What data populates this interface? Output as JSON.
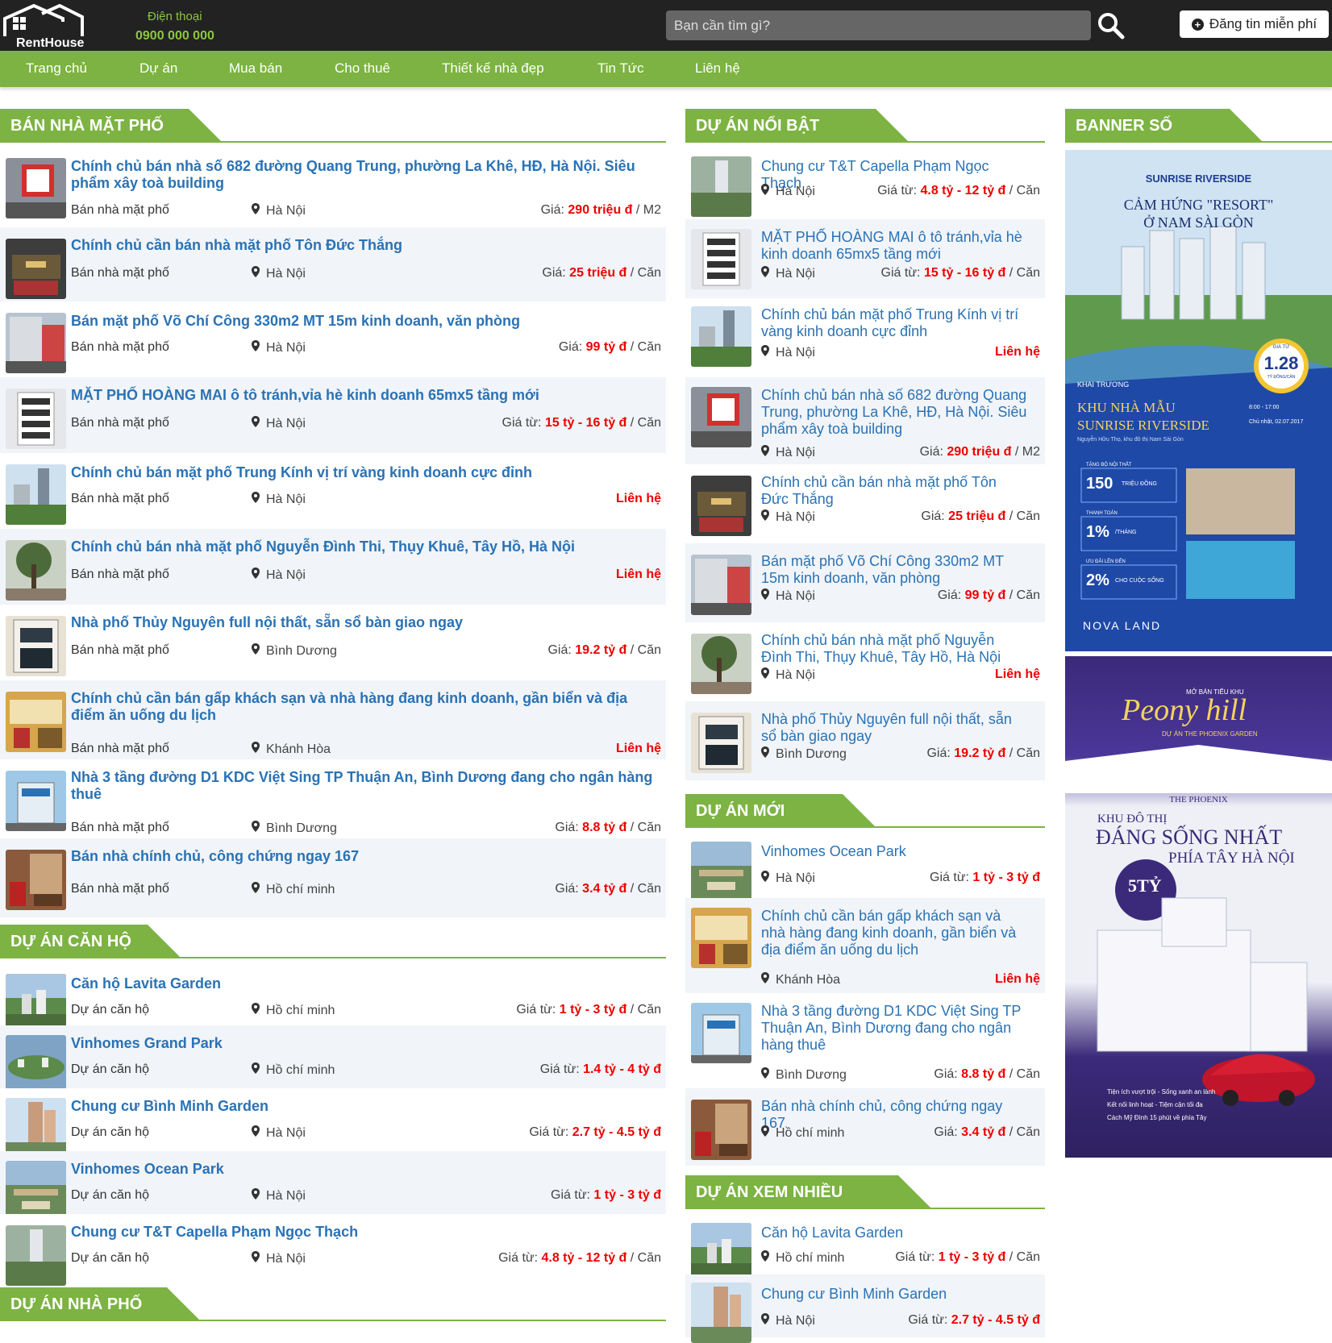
{
  "header": {
    "logo": "RentHouse",
    "phone_label": "Điện thoại",
    "phone": "0900 000 000",
    "search_placeholder": "Bạn cần tìm gì?",
    "post_label": "Đăng tin miễn phí"
  },
  "nav": [
    "Trang chủ",
    "Dự án",
    "Mua bán",
    "Cho thuê",
    "Thiết kế nhà đẹp",
    "Tin Tức",
    "Liên hệ"
  ],
  "sections": {
    "ban_nha": "BÁN NHÀ MẶT PHỐ",
    "can_ho": "DỰ ÁN CĂN HỘ",
    "nha_pho": "DỰ ÁN NHÀ PHỐ",
    "noi_bat": "DỰ ÁN NỔI BẬT",
    "moi": "DỰ ÁN MỚI",
    "xem_nhieu": "DỰ ÁN XEM NHIỀU",
    "banner": "BANNER SỐ"
  },
  "ban_nha": [
    {
      "title": "Chính chủ bán nhà số 682 đường Quang Trung, phường La Khê, HĐ, Hà Nội. Siêu phẩm xây toà building",
      "cat": "Bán nhà mặt phố",
      "loc": "Hà Nội",
      "pl": "Giá: ",
      "pv": "290 triệu đ",
      "pu": " / M2",
      "thumb": "red"
    },
    {
      "title": "Chính chủ cần bán nhà mặt phố Tôn Đức Thắng",
      "cat": "Bán nhà mặt phố",
      "loc": "Hà Nội",
      "pl": "Giá: ",
      "pv": "25 triệu đ",
      "pu": " / Căn",
      "thumb": "shop"
    },
    {
      "title": "Bán mặt phố Võ Chí Công 330m2 MT 15m kinh doanh, văn phòng",
      "cat": "Bán nhà mặt phố",
      "loc": "Hà Nội",
      "pl": "Giá: ",
      "pv": "99 tỷ đ",
      "pu": " / Căn",
      "thumb": "street"
    },
    {
      "title": "MẶT PHỐ HOÀNG MAI ô tô tránh,vỉa hè kinh doanh 65mx5 tầng mới",
      "cat": "Bán nhà mặt phố",
      "loc": "Hà Nội",
      "pl": "Giá từ: ",
      "pv": "15 tỷ - 16 tỷ đ",
      "pu": " / Căn",
      "thumb": "white"
    },
    {
      "title": "Chính chủ bán mặt phố Trung Kính vị trí vàng kinh doanh cực đỉnh",
      "cat": "Bán nhà mặt phố",
      "loc": "Hà Nội",
      "contact": "Liên hệ",
      "thumb": "city"
    },
    {
      "title": "Chính chủ bán nhà mặt phố Nguyễn Đình Thi, Thụy Khuê, Tây Hồ, Hà Nội",
      "cat": "Bán nhà mặt phố",
      "loc": "Hà Nội",
      "contact": "Liên hệ",
      "thumb": "tree"
    },
    {
      "title": "Nhà phố Thủy Nguyên full nội thất, sẵn sổ bàn giao ngay",
      "cat": "Bán nhà mặt phố",
      "loc": "Bình Dương",
      "pl": "Giá: ",
      "pv": "19.2 tỷ đ",
      "pu": " / Căn",
      "thumb": "house"
    },
    {
      "title": "Chính chủ cần bán gấp khách sạn và nhà hàng đang kinh doanh, gần biển và địa điểm ăn uống du lịch",
      "cat": "Bán nhà mặt phố",
      "loc": "Khánh Hòa",
      "contact": "Liên hệ",
      "thumb": "hotel"
    },
    {
      "title": "Nhà 3 tầng đường D1 KDC Việt Sing TP Thuận An, Bình Dương đang cho ngân hàng thuê",
      "cat": "Bán nhà mặt phố",
      "loc": "Bình Dương",
      "pl": "Giá: ",
      "pv": "8.8 tỷ đ",
      "pu": " / Căn",
      "thumb": "blue"
    },
    {
      "title": "Bán nhà chính chủ, công chứng ngay 167",
      "cat": "Bán nhà mặt phố",
      "loc": "Hồ chí minh",
      "pl": "Giá: ",
      "pv": "3.4 tỷ đ",
      "pu": " / Căn",
      "thumb": "interior"
    }
  ],
  "can_ho": [
    {
      "title": "Căn hộ Lavita Garden",
      "cat": "Dự án căn hộ",
      "loc": "Hồ chí minh",
      "pl": "Giá từ: ",
      "pv": "1 tỷ - 3 tỷ đ",
      "pu": " / Căn",
      "thumb": "aerial"
    },
    {
      "title": "Vinhomes Grand Park",
      "cat": "Dự án căn hộ",
      "loc": "Hồ chí minh",
      "pl": "Giá từ: ",
      "pv": "1.4 tỷ - 4 tỷ đ",
      "pu": "",
      "thumb": "park"
    },
    {
      "title": "Chung cư Bình Minh Garden",
      "cat": "Dự án căn hộ",
      "loc": "Hà Nội",
      "pl": "Giá từ: ",
      "pv": "2.7 tỷ - 4.5 tỷ đ",
      "pu": "",
      "thumb": "tower"
    },
    {
      "title": "Vinhomes Ocean Park",
      "cat": "Dự án căn hộ",
      "loc": "Hà Nội",
      "pl": "Giá từ: ",
      "pv": "1 tỷ - 3 tỷ đ",
      "pu": "",
      "thumb": "ocean"
    },
    {
      "title": "Chung cư T&T Capella Phạm Ngọc Thạch",
      "cat": "Dự án căn hộ",
      "loc": "Hà Nội",
      "pl": "Giá từ: ",
      "pv": "4.8 tỷ - 12 tỷ đ",
      "pu": " / Căn",
      "thumb": "capella"
    }
  ],
  "noi_bat": [
    {
      "title": "Chung cư T&T Capella Phạm Ngọc Thạch",
      "loc": "Hà Nội",
      "pl": "Giá từ: ",
      "pv": "4.8 tỷ - 12 tỷ đ",
      "pu": " / Căn",
      "thumb": "capella"
    },
    {
      "title": "MẶT PHỐ HOÀNG MAI ô tô tránh,vỉa hè kinh doanh 65mx5 tầng mới",
      "loc": "Hà Nội",
      "pl": "Giá từ: ",
      "pv": "15 tỷ - 16 tỷ đ",
      "pu": " / Căn",
      "thumb": "white"
    },
    {
      "title": "Chính chủ bán mặt phố Trung Kính vị trí vàng kinh doanh cực đỉnh",
      "loc": "Hà Nội",
      "contact": "Liên hệ",
      "thumb": "city"
    },
    {
      "title": "Chính chủ bán nhà số 682 đường Quang Trung, phường La Khê, HĐ, Hà Nội. Siêu phẩm xây toà building",
      "loc": "Hà Nội",
      "pl": "Giá: ",
      "pv": "290 triệu đ",
      "pu": " / M2",
      "thumb": "red"
    },
    {
      "title": "Chính chủ cần bán nhà mặt phố Tôn Đức Thắng",
      "loc": "Hà Nội",
      "pl": "Giá: ",
      "pv": "25 triệu đ",
      "pu": " / Căn",
      "thumb": "shop"
    },
    {
      "title": "Bán mặt phố Võ Chí Công 330m2 MT 15m kinh doanh, văn phòng",
      "loc": "Hà Nội",
      "pl": "Giá: ",
      "pv": "99 tỷ đ",
      "pu": " / Căn",
      "thumb": "street"
    },
    {
      "title": "Chính chủ bán nhà mặt phố Nguyễn Đình Thi, Thụy Khuê, Tây Hồ, Hà Nội",
      "loc": "Hà Nội",
      "contact": "Liên hệ",
      "thumb": "tree"
    },
    {
      "title": "Nhà phố Thủy Nguyên full nội thất, sẵn sổ bàn giao ngay",
      "loc": "Bình Dương",
      "pl": "Giá: ",
      "pv": "19.2 tỷ đ",
      "pu": " / Căn",
      "thumb": "house"
    }
  ],
  "moi": [
    {
      "title": "Vinhomes Ocean Park",
      "loc": "Hà Nội",
      "pl": "Giá từ: ",
      "pv": "1 tỷ - 3 tỷ đ",
      "pu": "",
      "thumb": "ocean"
    },
    {
      "title": "Chính chủ cần bán gấp khách sạn và nhà hàng đang kinh doanh, gần biển và địa điểm ăn uống du lịch",
      "loc": "Khánh Hòa",
      "contact": "Liên hệ",
      "thumb": "hotel"
    },
    {
      "title": "Nhà 3 tầng đường D1 KDC Việt Sing TP Thuận An, Bình Dương đang cho ngân hàng thuê",
      "loc": "Bình Dương",
      "pl": "Giá: ",
      "pv": "8.8 tỷ đ",
      "pu": " / Căn",
      "thumb": "blue"
    },
    {
      "title": "Bán nhà chính chủ, công chứng ngay 167",
      "loc": "Hồ chí minh",
      "pl": "Giá: ",
      "pv": "3.4 tỷ đ",
      "pu": " / Căn",
      "thumb": "interior"
    }
  ],
  "xem_nhieu": [
    {
      "title": "Căn hộ Lavita Garden",
      "loc": "Hồ chí minh",
      "pl": "Giá từ: ",
      "pv": "1 tỷ - 3 tỷ đ",
      "pu": " / Căn",
      "thumb": "aerial"
    },
    {
      "title": "Chung cư Bình Minh Garden",
      "loc": "Hà Nội",
      "pl": "Giá từ: ",
      "pv": "2.7 tỷ - 4.5 tỷ đ",
      "pu": "",
      "thumb": "tower"
    }
  ],
  "banner1": {
    "brand": "SUNRISE RIVERSIDE",
    "headline1": "CẢM HỨNG \"RESORT\"",
    "headline2": "Ở NAM SÀI GÒN",
    "price_top": "GIÁ TỪ",
    "price": "1.28",
    "price_unit": "TỶ ĐỒNG/CĂN",
    "open_label": "KHAI TRƯƠNG",
    "house_line1": "KHU NHÀ MẪU",
    "house_line2": "SUNRISE RIVERSIDE",
    "time": "8:00 - 17:00",
    "date": "Chủ nhật, 02.07.2017",
    "address": "Nguyễn Hữu Thọ, khu đô thị Nam Sài Gòn",
    "offers": [
      {
        "tag": "TẶNG BỘ NỘI THẤT",
        "value": "150",
        "unit": "TRIỆU ĐỒNG"
      },
      {
        "tag": "THANH TOÁN",
        "value": "1%",
        "unit": "/THÁNG"
      },
      {
        "tag": "ƯU ĐÃI LÊN ĐẾN",
        "value": "2%",
        "unit": "CHO CUỘC SỐNG"
      }
    ],
    "logo": "NOVA LAND"
  },
  "banner2": {
    "top_small": "MỞ BÁN TIỂU KHU",
    "script": "Peony hill",
    "sub": "DỰ ÁN THE PHOENIX GARDEN",
    "phoenix": "THE PHOENIX",
    "line1": "KHU ĐÔ THỊ",
    "line2": "ĐÁNG SỐNG NHẤT",
    "line3": "PHÍA TÂY HÀ NỘI",
    "badge": "5TỶ",
    "bullets": [
      "Tiện ích vượt trội - Sống xanh an lành",
      "Kết nối linh hoạt - Tiệm cận tối đa",
      "Cách Mỹ Đình 15 phút về phía Tây"
    ]
  },
  "colors": {
    "green": "#7cb342",
    "title_blue": "#2a72b5",
    "price_red": "#e00000",
    "topbar": "#222222"
  }
}
